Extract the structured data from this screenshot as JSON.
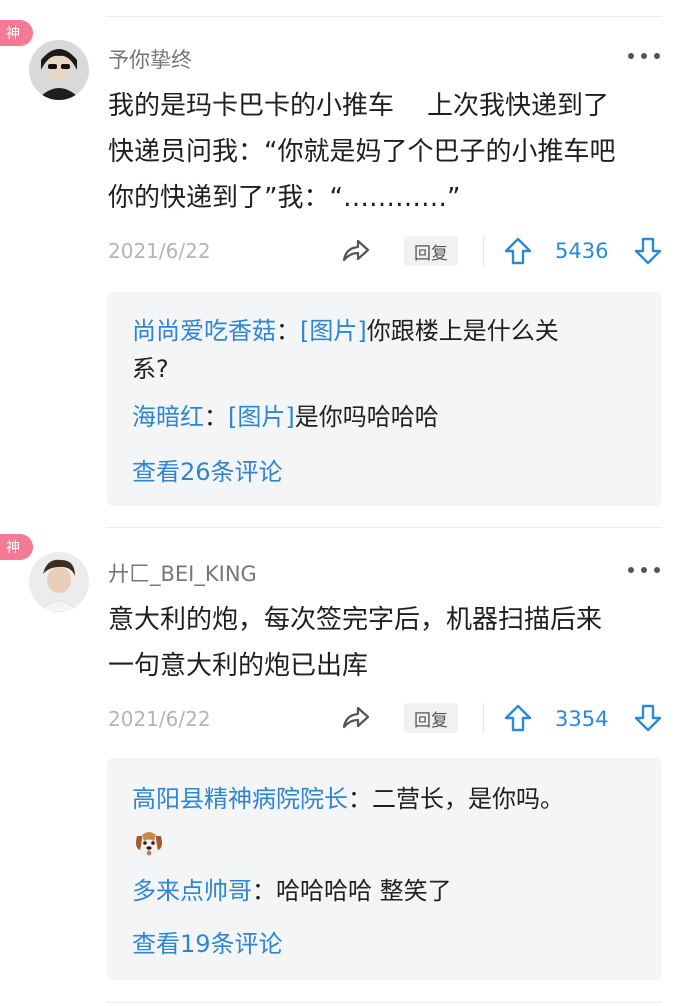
{
  "badge_label": "神",
  "comments": [
    {
      "username": "予你挚终",
      "content_lines": [
        "我的是玛卡巴卡的小推车    上次我快递到了",
        "快递员问我：“你就是妈了个巴子的小推车吧",
        "你的快递到了”我：“…………”"
      ],
      "date": "2021/6/22",
      "reply_label": "回复",
      "likes": "5436",
      "replies": [
        {
          "author": "尚尚爱吃香菇",
          "sep": "：",
          "image_tag": "[图片]",
          "text": "你跟楼上是什么关",
          "text_cont": "系?"
        },
        {
          "author": "海暗红",
          "sep": "：",
          "image_tag": "[图片]",
          "text": "是你吗哈哈哈"
        }
      ],
      "view_more": "查看26条评论"
    },
    {
      "username": "廾匚_BEI_KING",
      "content_lines": [
        "意大利的炮，每次签完字后，机器扫描后来",
        "一句意大利的炮已出库"
      ],
      "date": "2021/6/22",
      "reply_label": "回复",
      "likes": "3354",
      "replies": [
        {
          "author": "高阳县精神病院院长",
          "sep": "：",
          "text": "二营长，是你吗。",
          "emoji": "dog-emoji"
        },
        {
          "author": "多来点帅哥",
          "sep": "：",
          "text": "哈哈哈哈 整笑了"
        }
      ],
      "view_more": "查看19条评论"
    }
  ],
  "colors": {
    "badge": "#f47a95",
    "link": "#2e86d1",
    "like_count": "#2a8ad8",
    "reply_box": "#f4f5f7"
  }
}
